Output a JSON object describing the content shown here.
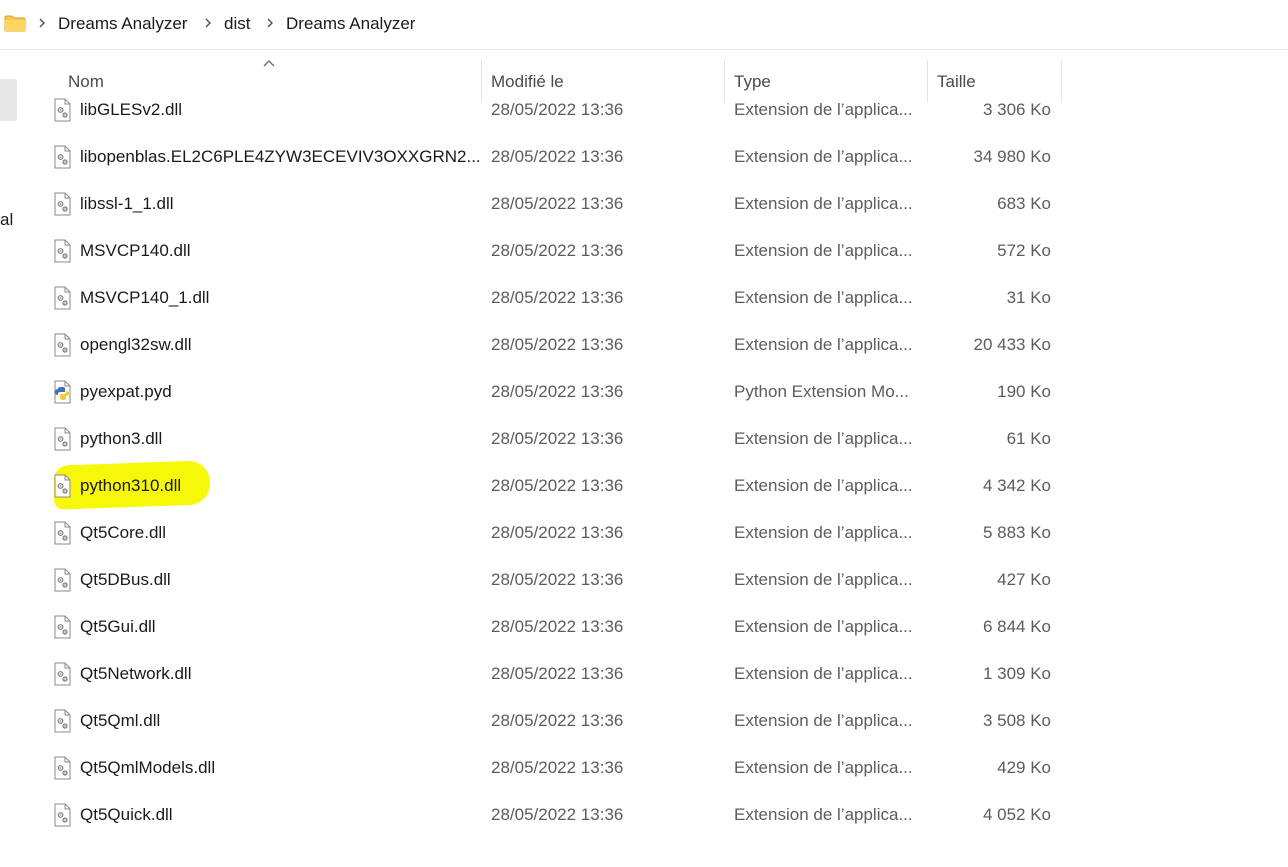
{
  "breadcrumb": [
    "Dreams Analyzer",
    "dist",
    "Dreams Analyzer"
  ],
  "nav_cut_text": "al",
  "columns": {
    "name": "Nom",
    "modified": "Modifié le",
    "type": "Type",
    "size": "Taille"
  },
  "highlight_color": "#f7f70a",
  "files": [
    {
      "name": "libGLESv2.dll",
      "date": "28/05/2022 13:36",
      "type": "Extension de l’applica...",
      "size": "3 306 Ko",
      "icon": "dll-file-icon"
    },
    {
      "name": "libopenblas.EL2C6PLE4ZYW3ECEVIV3OXXGRN2...",
      "date": "28/05/2022 13:36",
      "type": "Extension de l’applica...",
      "size": "34 980 Ko",
      "icon": "dll-file-icon"
    },
    {
      "name": "libssl-1_1.dll",
      "date": "28/05/2022 13:36",
      "type": "Extension de l’applica...",
      "size": "683 Ko",
      "icon": "dll-file-icon"
    },
    {
      "name": "MSVCP140.dll",
      "date": "28/05/2022 13:36",
      "type": "Extension de l’applica...",
      "size": "572 Ko",
      "icon": "dll-file-icon"
    },
    {
      "name": "MSVCP140_1.dll",
      "date": "28/05/2022 13:36",
      "type": "Extension de l’applica...",
      "size": "31 Ko",
      "icon": "dll-file-icon"
    },
    {
      "name": "opengl32sw.dll",
      "date": "28/05/2022 13:36",
      "type": "Extension de l’applica...",
      "size": "20 433 Ko",
      "icon": "dll-file-icon"
    },
    {
      "name": "pyexpat.pyd",
      "date": "28/05/2022 13:36",
      "type": "Python Extension Mo...",
      "size": "190 Ko",
      "icon": "python-file-icon"
    },
    {
      "name": "python3.dll",
      "date": "28/05/2022 13:36",
      "type": "Extension de l’applica...",
      "size": "61 Ko",
      "icon": "dll-file-icon"
    },
    {
      "name": "python310.dll",
      "date": "28/05/2022 13:36",
      "type": "Extension de l’applica...",
      "size": "4 342 Ko",
      "icon": "dll-file-icon",
      "highlighted": true
    },
    {
      "name": "Qt5Core.dll",
      "date": "28/05/2022 13:36",
      "type": "Extension de l’applica...",
      "size": "5 883 Ko",
      "icon": "dll-file-icon"
    },
    {
      "name": "Qt5DBus.dll",
      "date": "28/05/2022 13:36",
      "type": "Extension de l’applica...",
      "size": "427 Ko",
      "icon": "dll-file-icon"
    },
    {
      "name": "Qt5Gui.dll",
      "date": "28/05/2022 13:36",
      "type": "Extension de l’applica...",
      "size": "6 844 Ko",
      "icon": "dll-file-icon"
    },
    {
      "name": "Qt5Network.dll",
      "date": "28/05/2022 13:36",
      "type": "Extension de l’applica...",
      "size": "1 309 Ko",
      "icon": "dll-file-icon"
    },
    {
      "name": "Qt5Qml.dll",
      "date": "28/05/2022 13:36",
      "type": "Extension de l’applica...",
      "size": "3 508 Ko",
      "icon": "dll-file-icon"
    },
    {
      "name": "Qt5QmlModels.dll",
      "date": "28/05/2022 13:36",
      "type": "Extension de l’applica...",
      "size": "429 Ko",
      "icon": "dll-file-icon"
    },
    {
      "name": "Qt5Quick.dll",
      "date": "28/05/2022 13:36",
      "type": "Extension de l’applica...",
      "size": "4 052 Ko",
      "icon": "dll-file-icon"
    }
  ]
}
